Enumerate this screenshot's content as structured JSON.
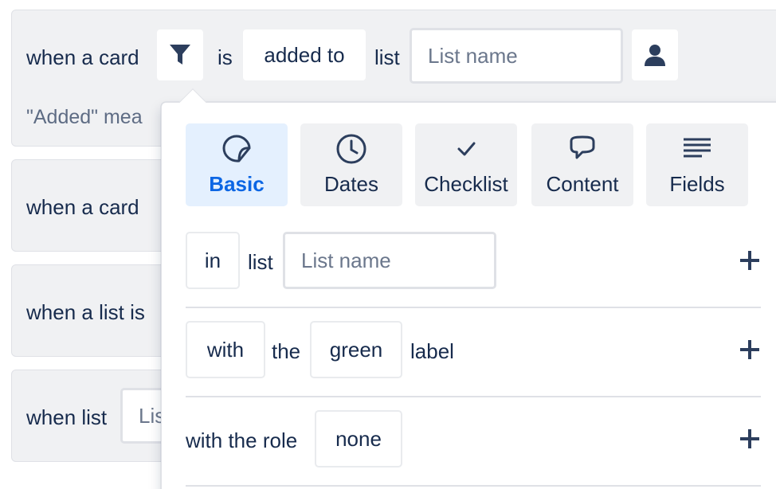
{
  "triggers": [
    {
      "prefix": "when a card",
      "is": "is",
      "action": "added to",
      "list_word": "list",
      "list_placeholder": "List name",
      "hint": "\"Added\" mea"
    },
    {
      "prefix": "when a card"
    },
    {
      "prefix": "when a list is"
    },
    {
      "prefix": "when list",
      "input_partial": "Lis"
    }
  ],
  "popover": {
    "tabs": [
      {
        "label": "Basic",
        "icon": "sticker-icon",
        "active": true
      },
      {
        "label": "Dates",
        "icon": "clock-icon",
        "active": false
      },
      {
        "label": "Checklist",
        "icon": "checkmark-icon",
        "active": false
      },
      {
        "label": "Content",
        "icon": "speech-bubble-icon",
        "active": false
      },
      {
        "label": "Fields",
        "icon": "lines-icon",
        "active": false
      }
    ],
    "filters": [
      {
        "chip": "in",
        "text": "list",
        "placeholder": "List name"
      },
      {
        "chip": "with",
        "text": "the",
        "chip2": "green",
        "text2": "label"
      },
      {
        "text": "with the role",
        "chip": "none"
      }
    ]
  },
  "colors": {
    "accent": "#0c66e4",
    "text": "#172b4d",
    "panel": "#f0f1f3"
  }
}
